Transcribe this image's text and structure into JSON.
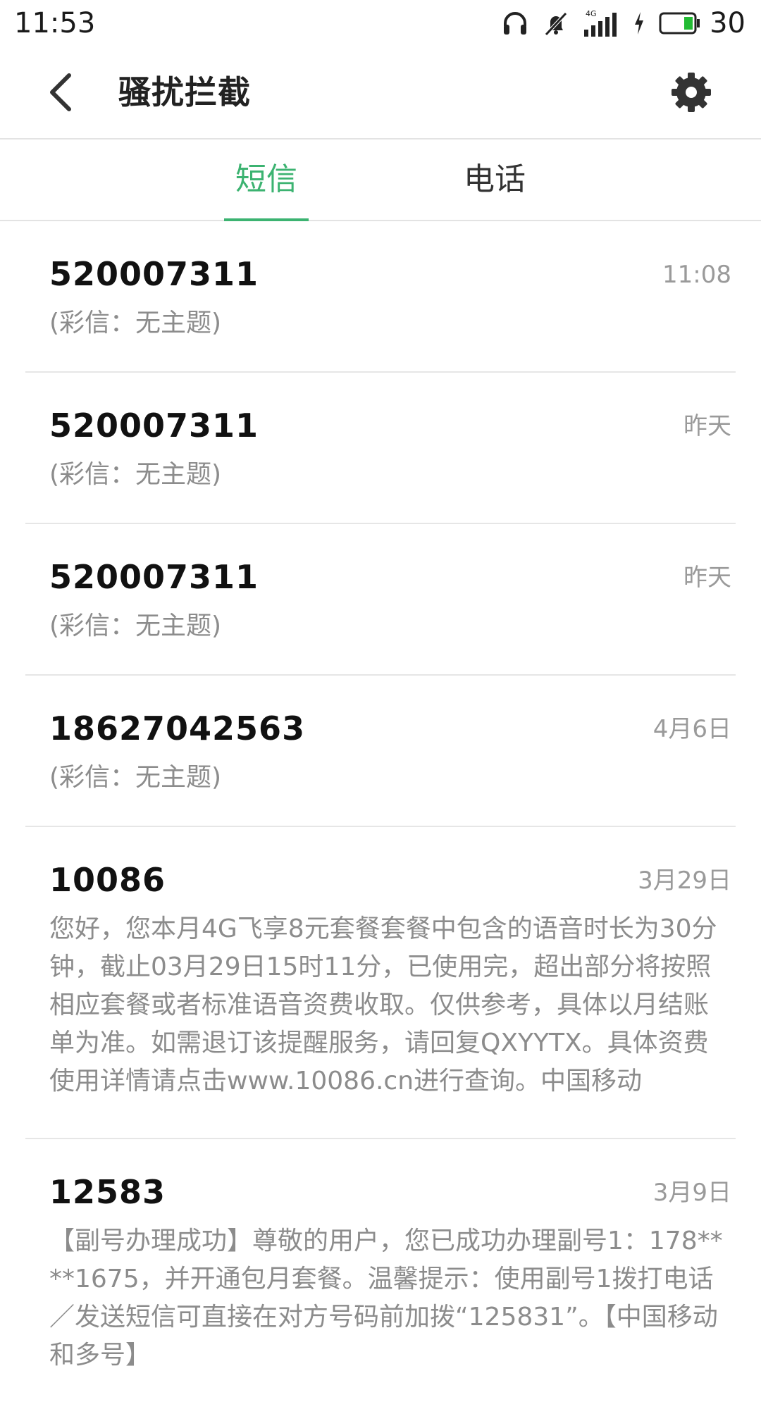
{
  "status_bar": {
    "time": "11:53",
    "battery": "30",
    "network": "4G"
  },
  "app_bar": {
    "title": "骚扰拦截"
  },
  "tabs": [
    {
      "label": "短信",
      "active": true
    },
    {
      "label": "电话",
      "active": false
    }
  ],
  "messages": [
    {
      "sender": "520007311",
      "time": "11:08",
      "preview": "(彩信：无主题)"
    },
    {
      "sender": "520007311",
      "time": "昨天",
      "preview": "(彩信：无主题)"
    },
    {
      "sender": "520007311",
      "time": "昨天",
      "preview": "(彩信：无主题)"
    },
    {
      "sender": "18627042563",
      "time": "4月6日",
      "preview": "(彩信：无主题)"
    },
    {
      "sender": "10086",
      "time": "3月29日",
      "preview": "您好，您本月4G飞享8元套餐套餐中包含的语音时长为30分钟，截止03月29日15时11分，已使用完，超出部分将按照相应套餐或者标准语音资费收取。仅供参考，具体以月结账单为准。如需退订该提醒服务，请回复QXYYTX。具体资费使用详情请点击www.10086.cn进行查询。中国移动"
    },
    {
      "sender": "12583",
      "time": "3月9日",
      "preview": "【副号办理成功】尊敬的用户，您已成功办理副号1：178****1675，并开通包月套餐。温馨提示：使用副号1拨打电话／发送短信可直接在对方号码前加拨“125831”。【中国移动 和多号】"
    }
  ],
  "colors": {
    "accent": "#3cb371",
    "secondary_text": "#8c8c8c"
  }
}
